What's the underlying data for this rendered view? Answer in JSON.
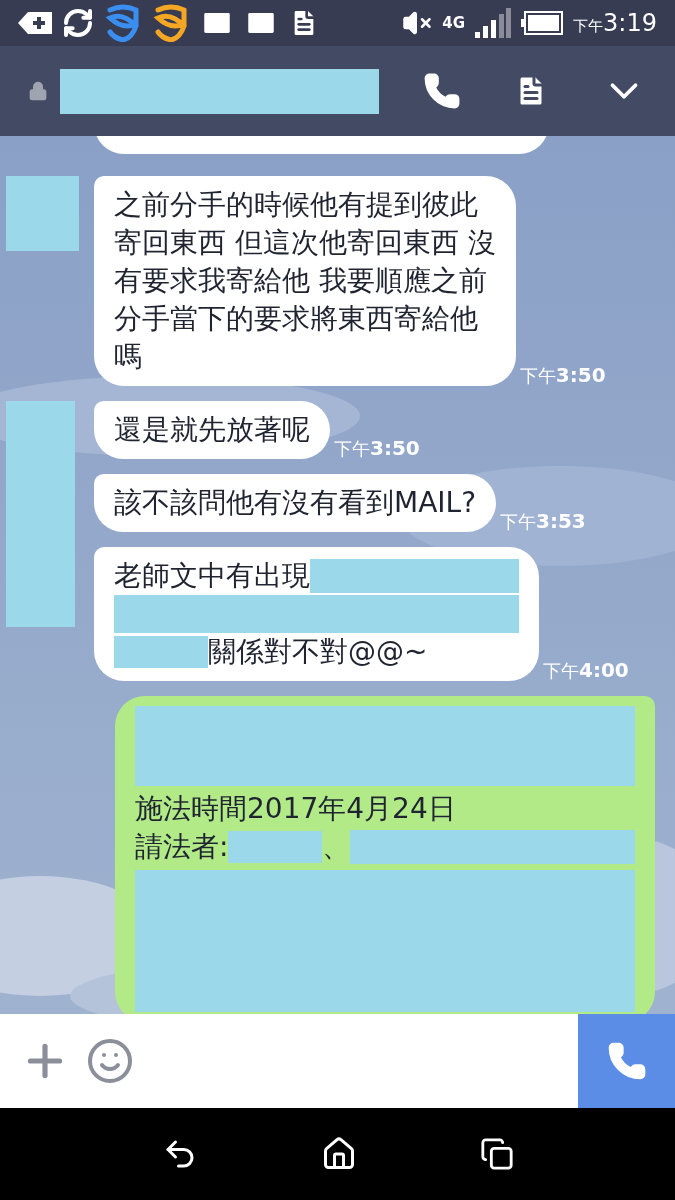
{
  "status_bar": {
    "network": "4G",
    "time_prefix": "下午",
    "time": "3:19"
  },
  "header": {
    "name": {
      "kind": "redacted"
    }
  },
  "groups": [
    {
      "outgoing": false,
      "avatar": {
        "kind": "redacted"
      },
      "messages": [
        {
          "lines": [
            [
              {
                "kind": "text",
                "text": "之前分手的時候他有提到彼此"
              }
            ],
            [
              {
                "kind": "text",
                "text": "寄回東西 但這次他寄回東西 沒"
              }
            ],
            [
              {
                "kind": "text",
                "text": "有要求我寄給他 我要順應之前"
              }
            ],
            [
              {
                "kind": "text",
                "text": "分手當下的要求將東西寄給他"
              }
            ],
            [
              {
                "kind": "text",
                "text": "嗎"
              }
            ]
          ],
          "time_prefix": "下午",
          "time": "3:50"
        }
      ]
    },
    {
      "outgoing": false,
      "avatar": {
        "kind": "redacted"
      },
      "messages": [
        {
          "lines": [
            [
              {
                "kind": "text",
                "text": "還是就先放著呢"
              }
            ]
          ],
          "time_prefix": "下午",
          "time": "3:50"
        },
        {
          "lines": [
            [
              {
                "kind": "text",
                "text": "該不該問他有沒有看到MAIL?"
              }
            ]
          ],
          "time_prefix": "下午",
          "time": "3:53"
        },
        {
          "lines": [
            [
              {
                "kind": "text",
                "text": "老師文中有出現"
              },
              {
                "kind": "redacted"
              }
            ],
            [
              {
                "kind": "redacted"
              }
            ],
            [
              {
                "kind": "redacted"
              },
              {
                "kind": "text",
                "text": "關係對不對@@~"
              }
            ]
          ],
          "time_prefix": "下午",
          "time": "4:00"
        }
      ]
    },
    {
      "outgoing": true,
      "messages": [
        {
          "lines": [
            [
              {
                "kind": "redacted"
              }
            ],
            [
              {
                "kind": "text",
                "text": "施法時間2017年4月24日"
              }
            ],
            [
              {
                "kind": "text",
                "text": "請法者:"
              },
              {
                "kind": "redacted"
              },
              {
                "kind": "text",
                "text": "、"
              },
              {
                "kind": "redacted"
              }
            ],
            [
              {
                "kind": "redacted"
              }
            ]
          ]
        }
      ]
    }
  ]
}
